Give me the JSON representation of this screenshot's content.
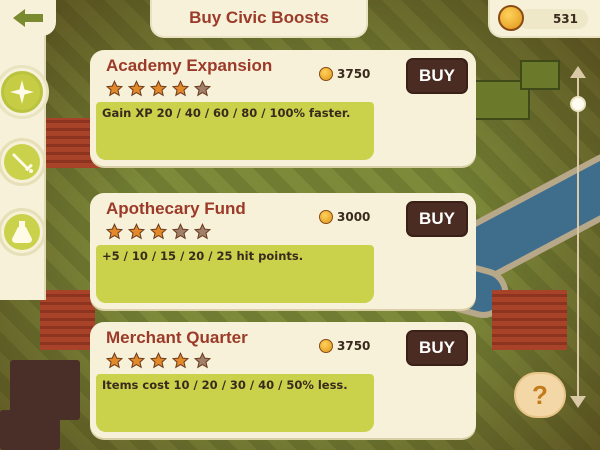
{
  "header": {
    "title": "Buy Civic Boosts",
    "back_icon": "back-arrow-icon"
  },
  "currency": {
    "icon": "coin-icon",
    "amount": "531"
  },
  "sidebar": {
    "items": [
      {
        "icon": "sparkle-icon",
        "active": true
      },
      {
        "icon": "sword-icon",
        "active": false
      },
      {
        "icon": "potion-flask-icon",
        "active": false
      }
    ]
  },
  "boosts": [
    {
      "name": "Academy Expansion",
      "rating_filled": 4,
      "rating_total": 5,
      "price": "3750",
      "buy_label": "BUY",
      "description": "Gain XP 20 / 40 / 60 / 80 / 100% faster."
    },
    {
      "name": "Apothecary Fund",
      "rating_filled": 3,
      "rating_total": 5,
      "price": "3000",
      "buy_label": "BUY",
      "description": "+5 / 10 / 15 / 20 / 25 hit points."
    },
    {
      "name": "Merchant Quarter",
      "rating_filled": 4,
      "rating_total": 5,
      "price": "3750",
      "buy_label": "BUY",
      "description": "Items cost 10 / 20 / 30 / 40 / 50% less."
    }
  ],
  "help": {
    "label": "?"
  },
  "colors": {
    "panel": "#f6f1d8",
    "title_text": "#9c3a2a",
    "desc_bg": "#c9d24a",
    "buy_button": "#4a2c22",
    "star_filled": "#e3892a",
    "star_empty": "#a0806a"
  }
}
